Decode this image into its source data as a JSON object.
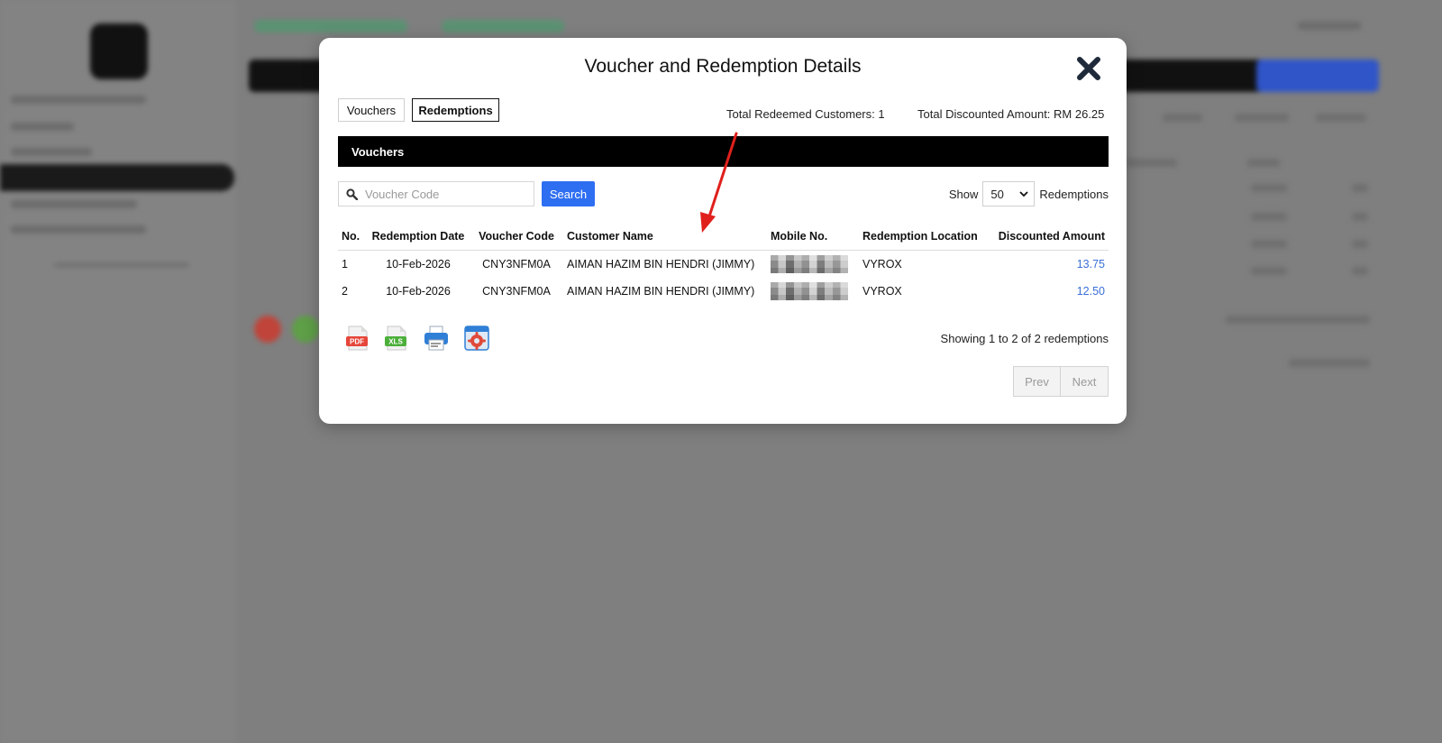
{
  "modal": {
    "title": "Voucher and Redemption Details",
    "tabs": [
      "Vouchers",
      "Redemptions"
    ],
    "active_tab": "Redemptions",
    "total_customers": "Total Redeemed Customers: 1",
    "total_amount": "Total Discounted Amount: RM 26.25",
    "section_title": "Vouchers",
    "search": {
      "placeholder": "Voucher Code",
      "button": "Search"
    },
    "show": {
      "prefix": "Show",
      "value": "50",
      "suffix": "Redemptions"
    },
    "table": {
      "headers": [
        "No.",
        "Redemption Date",
        "Voucher Code",
        "Customer Name",
        "Mobile No.",
        "Redemption Location",
        "Discounted Amount"
      ],
      "rows": [
        {
          "no": "1",
          "date": "10-Feb-2026",
          "code": "CNY3NFM0A",
          "name": "AIMAN HAZIM BIN HENDRI (JIMMY)",
          "location": "VYROX",
          "amount": "13.75"
        },
        {
          "no": "2",
          "date": "10-Feb-2026",
          "code": "CNY3NFM0A",
          "name": "AIMAN HAZIM BIN HENDRI (JIMMY)",
          "location": "VYROX",
          "amount": "12.50"
        }
      ]
    },
    "export_icons": [
      "pdf-icon",
      "xls-icon",
      "print-icon",
      "settings-icon"
    ],
    "showing": "Showing 1 to 2 of 2 redemptions",
    "pager": {
      "prev": "Prev",
      "next": "Next"
    },
    "colors": {
      "accent": "#2e6ff2",
      "amount_link": "#3a6fd8",
      "annotation_arrow": "#e0201c"
    }
  }
}
